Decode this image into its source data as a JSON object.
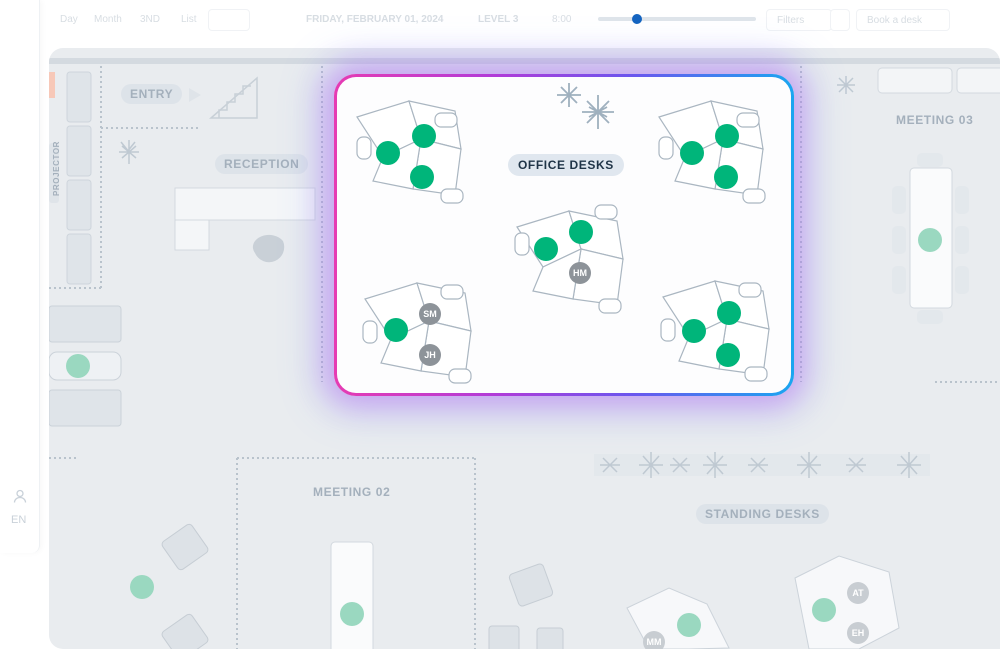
{
  "toolbar": {
    "view_day": "Day",
    "view_month": "Month",
    "view_3d": "3ND",
    "view_list": "List",
    "date": "FRIDAY, FEBRUARY 01, 2024",
    "level": "LEVEL 3",
    "time": "8:00",
    "filters_label": "Filters",
    "right_label": "Book a desk"
  },
  "rail": {
    "user_icon": "user-icon",
    "language": "EN"
  },
  "floor": {
    "labels": {
      "entry": "ENTRY",
      "reception": "RECEPTION",
      "projector": "PROJECTOR",
      "meeting_03": "MEETING 03",
      "meeting_02": "MEETING 02",
      "standing_desks": "STANDING DESKS"
    },
    "highlight_zone": {
      "title": "OFFICE DESKS",
      "border_gradient": [
        "#e63bb3",
        "#b13bd8",
        "#6a56ee",
        "#1aa6f0"
      ],
      "desk_clusters": [
        {
          "seats": [
            "available",
            "available",
            "available"
          ]
        },
        {
          "seats": [
            "available",
            "available",
            "available"
          ]
        },
        {
          "seats": [
            "available",
            "available",
            "HM"
          ]
        },
        {
          "seats": [
            "available",
            "SM",
            "JH"
          ]
        },
        {
          "seats": [
            "available",
            "available",
            "available"
          ]
        }
      ],
      "occupied_initials": [
        "HM",
        "SM",
        "JH"
      ]
    },
    "standing_occupants": [
      "MM",
      "AT",
      "EH"
    ]
  },
  "colors": {
    "available": "#00b57a",
    "occupied": "#8d9399",
    "canvas_bg": "#e9ecef"
  }
}
